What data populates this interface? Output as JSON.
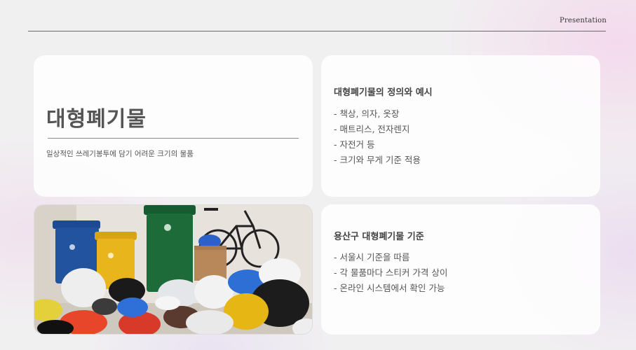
{
  "header": {
    "label": "Presentation"
  },
  "title_card": {
    "title": "대형폐기물",
    "subtitle": "일상적인 쓰레기봉투에 담기 어려운 크기의 물품"
  },
  "definition_card": {
    "heading": "대형폐기물의 정의와 예시",
    "items": [
      "- 책상, 의자, 옷장",
      "- 매트리스, 전자렌지",
      "- 자전거 등",
      "- 크기와 무게 기준 적용"
    ]
  },
  "yongsan_card": {
    "heading": "용산구 대형폐기물 기준",
    "items": [
      "- 서울시 기준을 따름",
      "- 각 물품마다 스티커 가격 상이",
      "- 온라인 시스템에서 확인 가능"
    ]
  },
  "photo": {
    "description_icon": "garbage-bins-bags-bicycle-photo",
    "colors": {
      "blue_bin": "#1f4f9a",
      "yellow_bin": "#e8b21a",
      "green_bin": "#1e6b3a",
      "wall": "#e6e1db"
    }
  }
}
